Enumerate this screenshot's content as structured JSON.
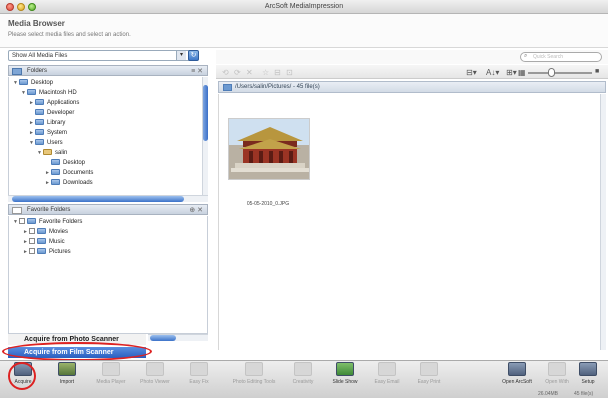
{
  "window": {
    "title": "ArcSoft MediaImpression"
  },
  "header": {
    "title": "Media Browser",
    "subtitle": "Please select media files and select an action."
  },
  "left": {
    "filter": {
      "value": "Show All Media Files"
    },
    "folders_panel": {
      "title": "Folders"
    },
    "tree": [
      {
        "label": "Desktop",
        "arrow": "▼",
        "checkbox": false
      },
      {
        "label": "Macintosh HD",
        "arrow": "▼",
        "checkbox": false
      },
      {
        "label": "Applications",
        "arrow": "►",
        "checkbox": false
      },
      {
        "label": "Developer",
        "arrow": "",
        "checkbox": false
      },
      {
        "label": "Library",
        "arrow": "►",
        "checkbox": false
      },
      {
        "label": "System",
        "arrow": "►",
        "checkbox": false
      },
      {
        "label": "Users",
        "arrow": "▼",
        "checkbox": false
      },
      {
        "label": "salin",
        "arrow": "▼",
        "checkbox": false
      },
      {
        "label": "Desktop",
        "arrow": "",
        "checkbox": false
      },
      {
        "label": "Documents",
        "arrow": "►",
        "checkbox": false
      },
      {
        "label": "Downloads",
        "arrow": "►",
        "checkbox": false
      }
    ],
    "favorites_panel": {
      "title": "Favorite Folders"
    },
    "favorites": [
      {
        "label": "Favorite Folders",
        "arrow": "▼"
      },
      {
        "label": "Movies",
        "arrow": "►"
      },
      {
        "label": "Music",
        "arrow": "►"
      },
      {
        "label": "Pictures",
        "arrow": "►"
      }
    ]
  },
  "popup": {
    "items": [
      {
        "label": "Acquire from Photo Scanner"
      },
      {
        "label": "Acquire from Film Scanner"
      }
    ]
  },
  "right": {
    "search": {
      "placeholder": "Quick Search"
    },
    "path": "/Users/salin/Pictures/ - 45 file(s)",
    "thumbnail": {
      "caption": "05-05-2010_0.JPG"
    }
  },
  "toolbar": {
    "items": [
      {
        "label": "Acquire",
        "enabled": true
      },
      {
        "label": "Import",
        "enabled": true
      },
      {
        "label": "Media Player",
        "enabled": false
      },
      {
        "label": "Photo Viewer",
        "enabled": false
      },
      {
        "label": "Easy Fix",
        "enabled": false
      },
      {
        "label": "Photo Editing Tools",
        "enabled": false
      },
      {
        "label": "Creativity",
        "enabled": false
      },
      {
        "label": "Slide Show",
        "enabled": true
      },
      {
        "label": "Easy Email",
        "enabled": false
      },
      {
        "label": "Easy Print",
        "enabled": false
      },
      {
        "label": "Open ArcSoft",
        "enabled": true
      },
      {
        "label": "Open With",
        "enabled": false
      },
      {
        "label": "Setup",
        "enabled": true
      }
    ]
  },
  "status": {
    "size": "26.04MB",
    "count": "45 file(s)"
  },
  "colors": {
    "accent": "#3a6fc8",
    "highlight_red": "#d22222"
  }
}
